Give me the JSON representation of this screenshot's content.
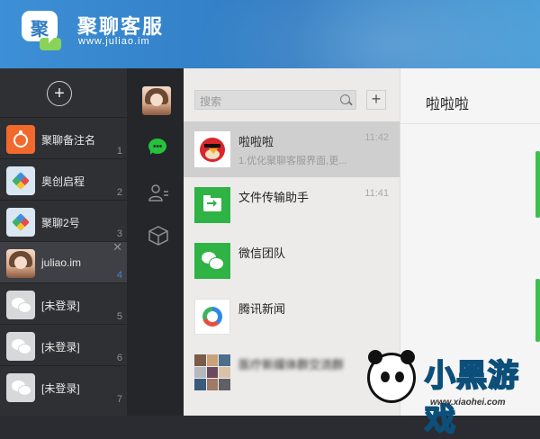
{
  "brand": {
    "title": "聚聊客服",
    "url": "www.juliao.im",
    "logo_glyph": "聚"
  },
  "accounts": {
    "add_label": "+",
    "items": [
      {
        "name": "聚聊备注名",
        "num": "1",
        "avatar": "orange-app-icon"
      },
      {
        "name": "奥创启程",
        "num": "2",
        "avatar": "pinwheel-icon"
      },
      {
        "name": "聚聊2号",
        "num": "3",
        "avatar": "pinwheel-icon"
      },
      {
        "name": "juliao.im",
        "num": "4",
        "avatar": "girl-photo",
        "selected": true,
        "close": "✕"
      },
      {
        "name": "[未登录]",
        "num": "5",
        "avatar": "wechat-gray-icon"
      },
      {
        "name": "[未登录]",
        "num": "6",
        "avatar": "wechat-gray-icon"
      },
      {
        "name": "[未登录]",
        "num": "7",
        "avatar": "wechat-gray-icon"
      }
    ]
  },
  "search": {
    "placeholder": "搜索",
    "add_label": "+"
  },
  "conversations": [
    {
      "title": "啦啦啦",
      "subtitle": "1.优化聚聊客服界面,更...",
      "time": "11:42",
      "icon": "angry-bird-avatar",
      "selected": true
    },
    {
      "title": "文件传输助手",
      "subtitle": "",
      "time": "11:41",
      "icon": "file-transfer-icon"
    },
    {
      "title": "微信团队",
      "subtitle": "",
      "time": "",
      "icon": "wechat-team-icon"
    },
    {
      "title": "腾讯新闻",
      "subtitle": "",
      "time": "",
      "icon": "tencent-news-icon"
    },
    {
      "title": "医疗新媒体群交流群",
      "subtitle": "",
      "time": "",
      "icon": "group-collage-avatar"
    }
  ],
  "chat": {
    "title": "啦啦啦"
  },
  "colors": {
    "accent_green": "#3cc04a",
    "header_blue": "#2f7bc2",
    "selected_account_num": "#4a7fd8"
  },
  "watermark": {
    "text": "小黑游戏",
    "url": "www.xiaohei.com"
  }
}
